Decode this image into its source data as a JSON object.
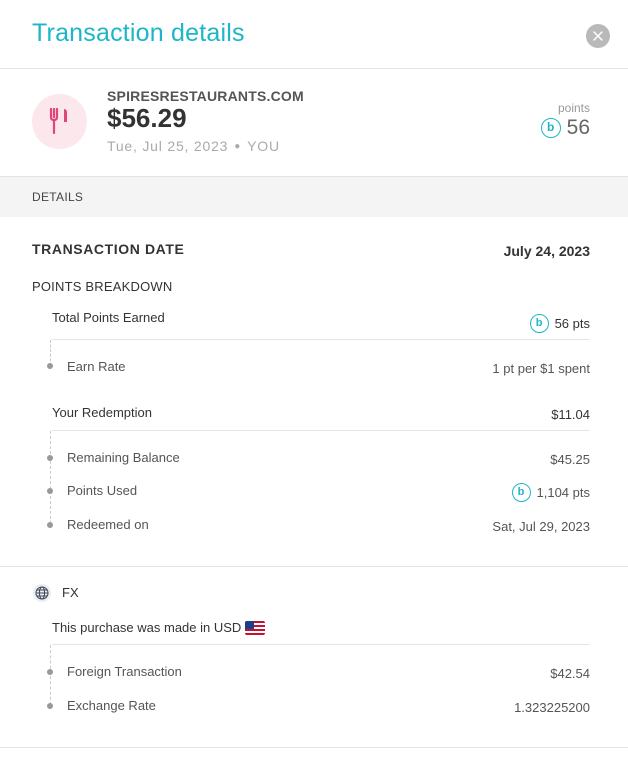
{
  "header": {
    "title": "Transaction details"
  },
  "summary": {
    "merchant": "SPIRESRESTAURANTS.COM",
    "amount": "$56.29",
    "date": "Tue, Jul 25, 2023",
    "who": "YOU",
    "points_label": "points",
    "points_value": "56",
    "category_icon": "fork-knife-icon"
  },
  "details_header": "DETAILS",
  "transaction": {
    "label": "TRANSACTION DATE",
    "date": "July 24, 2023"
  },
  "points_breakdown": {
    "label": "POINTS BREAKDOWN",
    "total_label": "Total Points Earned",
    "total_value": "56 pts",
    "earn_rate_label": "Earn Rate",
    "earn_rate_value": "1 pt per $1 spent",
    "redemption_label": "Your Redemption",
    "redemption_value": "$11.04",
    "remaining_label": "Remaining Balance",
    "remaining_value": "$45.25",
    "used_label": "Points Used",
    "used_value": "1,104 pts",
    "redeemed_label": "Redeemed on",
    "redeemed_value": "Sat, Jul 29, 2023"
  },
  "fx": {
    "label": "FX",
    "note": "This purchase was made in USD",
    "foreign_label": "Foreign Transaction",
    "foreign_value": "$42.54",
    "rate_label": "Exchange Rate",
    "rate_value": "1.323225200"
  },
  "badge_letter": "b",
  "colors": {
    "accent": "#1db6c8",
    "icon_pink": "#e0457b",
    "icon_bg": "#fce7ec"
  }
}
